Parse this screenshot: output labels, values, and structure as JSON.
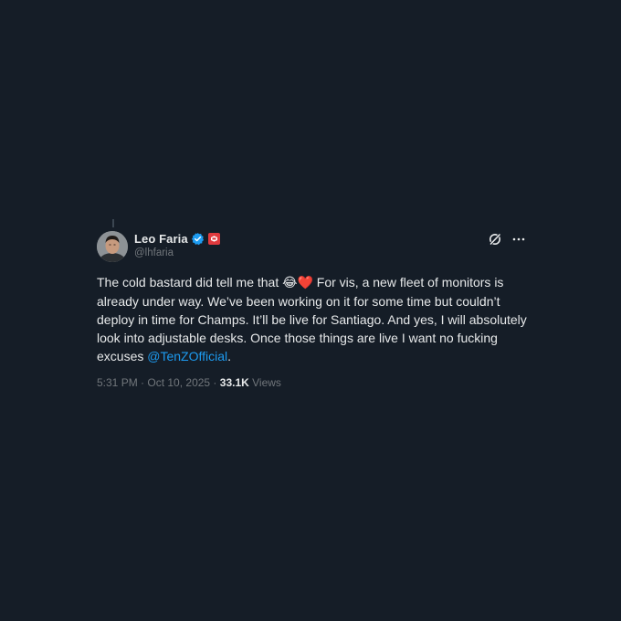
{
  "author": {
    "display_name": "Leo Faria",
    "handle": "@lhfaria",
    "verified": true,
    "affiliate_badge": "riot-games-badge"
  },
  "tweet": {
    "text_before_emoji": "The cold bastard did tell me that ",
    "emoji_1": "😂",
    "emoji_2": "❤️",
    "text_after_emoji": " For vis, a new fleet of monitors is already under way. We’ve been working on it for some time but couldn’t deploy in time for Champs. It’ll be live for Santiago. And yes, I will absolutely look into adjustable desks. Once those things are live I want no fucking excuses ",
    "mention": "@TenZOfficial",
    "text_end": "."
  },
  "meta": {
    "time": "5:31 PM",
    "separator_1": " · ",
    "date": "Oct 10, 2025",
    "separator_2": " · ",
    "views_count": "33.1K",
    "views_label": " Views"
  },
  "icons": {
    "grok": "grok-icon",
    "more": "more-icon"
  },
  "colors": {
    "background": "#151d27",
    "text": "#e7e9ea",
    "secondary": "#71767b",
    "link": "#1d9bf0",
    "verified": "#1d9bf0",
    "affiliate": "#e03a3e"
  }
}
